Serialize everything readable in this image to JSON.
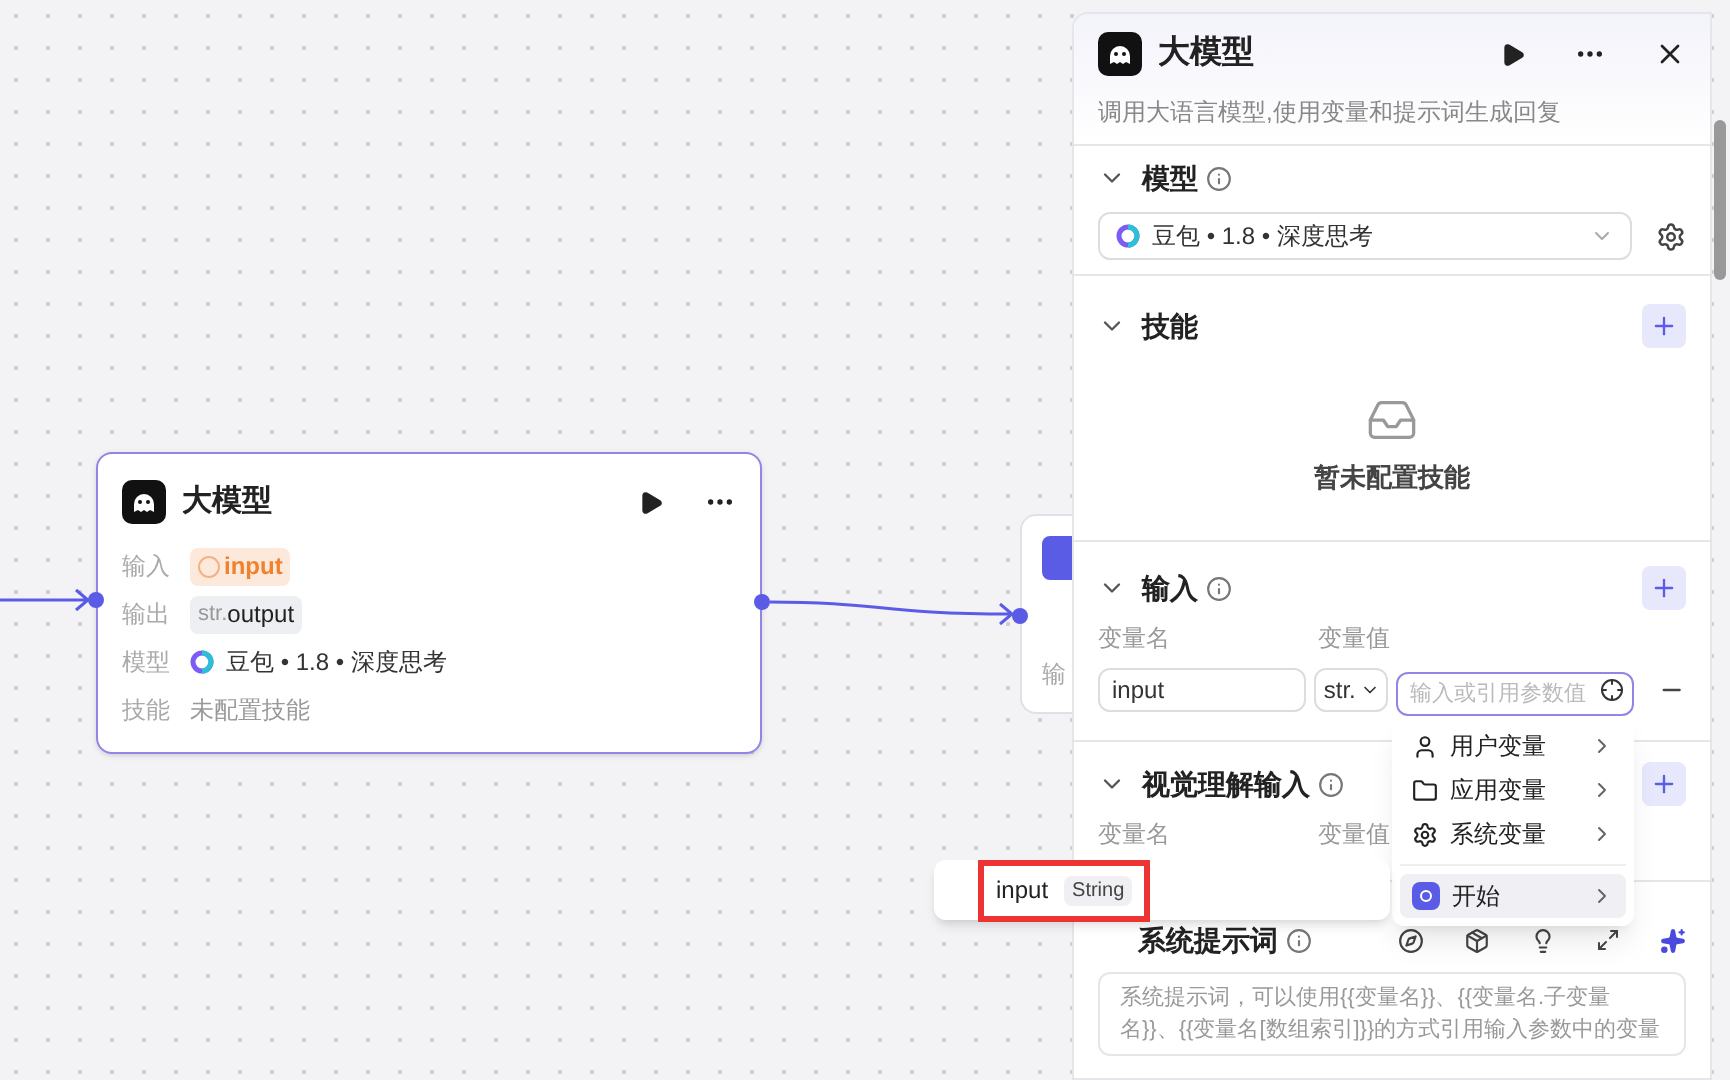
{
  "canvas": {
    "node": {
      "title": "大模型",
      "rows": [
        {
          "label": "输入",
          "kind": "input",
          "value": "input"
        },
        {
          "label": "输出",
          "kind": "output",
          "type": "str.",
          "value": "output"
        },
        {
          "label": "模型",
          "kind": "model",
          "value": "豆包 • 1.8 • 深度思考"
        },
        {
          "label": "技能",
          "kind": "text",
          "value": "未配置技能"
        }
      ]
    },
    "partial_node": {
      "label": "输"
    }
  },
  "panel": {
    "title": "大模型",
    "description": "调用大语言模型,使用变量和提示词生成回复",
    "model": {
      "title": "模型",
      "value": "豆包 • 1.8 • 深度思考"
    },
    "skills": {
      "title": "技能",
      "empty": "暂未配置技能"
    },
    "input": {
      "title": "输入",
      "columns": [
        "变量名",
        "变量值"
      ],
      "row": {
        "name": "input",
        "type": "str.",
        "placeholder": "输入或引用参数值"
      }
    },
    "vision": {
      "title": "视觉理解输入",
      "columns": [
        "变量名",
        "变量值"
      ]
    },
    "system_prompt": {
      "title": "系统提示词",
      "placeholder": "系统提示词，可以使用{{变量名}}、{{变量名.子变量名}}、{{变量名[数组索引]}}的方式引用输入参数中的变量"
    }
  },
  "dropdown": {
    "items": [
      {
        "label": "用户变量",
        "kind": "user",
        "selected": false
      },
      {
        "label": "应用变量",
        "kind": "folder",
        "selected": false
      },
      {
        "label": "系统变量",
        "kind": "gear",
        "selected": false
      },
      {
        "label": "开始",
        "kind": "node",
        "selected": true
      }
    ]
  },
  "tooltip": {
    "name": "input",
    "type": "String"
  }
}
